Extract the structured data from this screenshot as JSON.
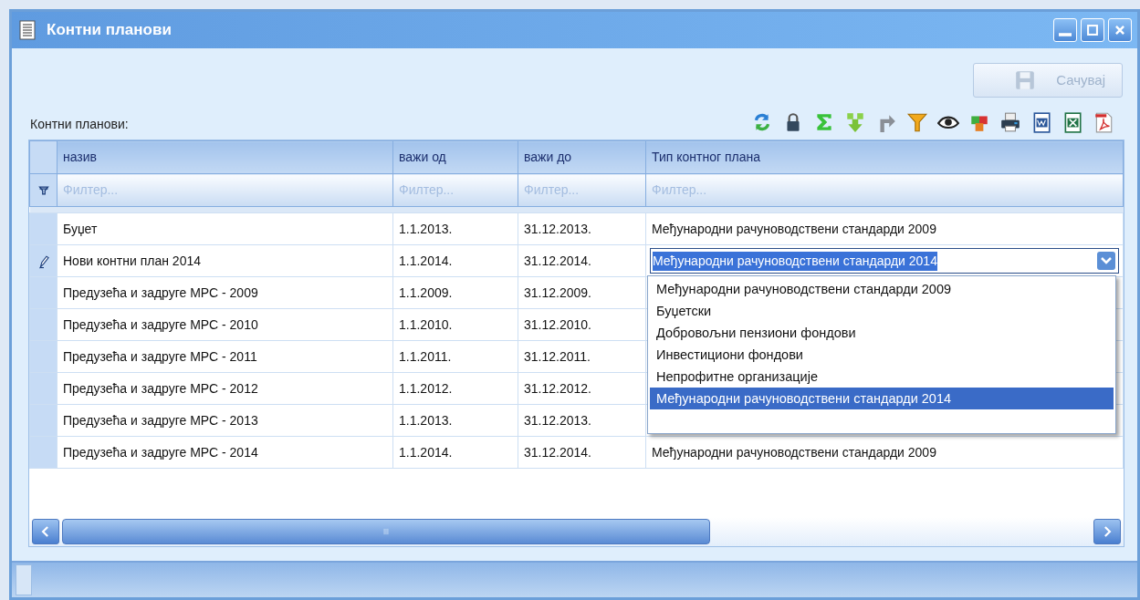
{
  "window": {
    "title": "Контни планови"
  },
  "save_button": {
    "label": "Сачувај",
    "disabled": true
  },
  "grid_label": "Контни планови:",
  "table": {
    "columns": [
      "назив",
      "важи од",
      "важи до",
      "Тип контног плана"
    ],
    "filter_placeholders": [
      "Филтер...",
      "Филтер...",
      "Филтер...",
      "Филтер..."
    ],
    "rows": [
      {
        "name": "Буџет",
        "valid_from": "1.1.2013.",
        "valid_to": "31.12.2013.",
        "type": "Међународни рачуноводствени стандарди 2009",
        "editing": false
      },
      {
        "name": "Нови контни план 2014",
        "valid_from": "1.1.2014.",
        "valid_to": "31.12.2014.",
        "type": "Међународни рачуноводствени стандарди 2014",
        "editing": true
      },
      {
        "name": "Предузећа и задруге МРС - 2009",
        "valid_from": "1.1.2009.",
        "valid_to": "31.12.2009.",
        "editing": false
      },
      {
        "name": "Предузећа и задруге МРС - 2010",
        "valid_from": "1.1.2010.",
        "valid_to": "31.12.2010.",
        "editing": false
      },
      {
        "name": "Предузећа и задруге МРС - 2011",
        "valid_from": "1.1.2011.",
        "valid_to": "31.12.2011.",
        "editing": false
      },
      {
        "name": "Предузећа и задруге МРС - 2012",
        "valid_from": "1.1.2012.",
        "valid_to": "31.12.2012.",
        "editing": false
      },
      {
        "name": "Предузећа и задруге МРС - 2013",
        "valid_from": "1.1.2013.",
        "valid_to": "31.12.2013.",
        "editing": false
      },
      {
        "name": "Предузећа и задруге МРС - 2014",
        "valid_from": "1.1.2014.",
        "valid_to": "31.12.2014.",
        "type": "Међународни рачуноводствени стандарди 2009",
        "editing": false
      }
    ]
  },
  "dropdown": {
    "items": [
      {
        "label": "Међународни рачуноводствени стандарди 2009",
        "selected": false
      },
      {
        "label": "Буџетски",
        "selected": false
      },
      {
        "label": "Добровољни пензиони фондови",
        "selected": false
      },
      {
        "label": "Инвестициони фондови",
        "selected": false
      },
      {
        "label": "Непрофитне организације",
        "selected": false
      },
      {
        "label": "Међународни рачуноводствени стандарди 2014",
        "selected": true
      }
    ]
  }
}
